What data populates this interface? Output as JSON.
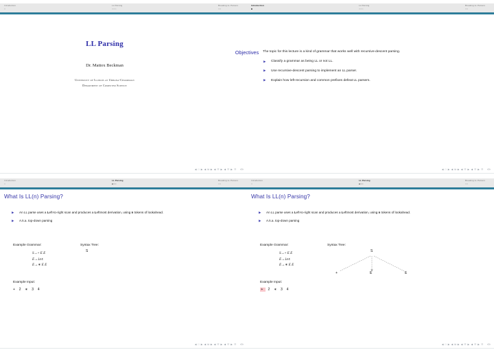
{
  "nav": {
    "sections": [
      "Introduction",
      "LL Parsing",
      "Breaking LL Parsers"
    ],
    "dots_intro_inactive": "○",
    "dots_intro_active": "■",
    "dots_ll": "○○○",
    "dots_ll_active": "●○○",
    "dots_breaking": "○○"
  },
  "footer": {
    "nav_glyphs": "◀ □ ▶ ◀ ⧉ ▶ ◀ ☷ ▶ ◀ ☷ ▶   ☷",
    "quad": "‹Ο›"
  },
  "slide1": {
    "header_title": "Objectives",
    "title": "LL Parsing",
    "author": "Dr. Mattox Beckman",
    "institution_line1": "University of Illinois at Urbana-Champaign",
    "institution_line2": "Department of Computer Science",
    "lead": "The topic for this lecture is a kind of grammar that works well with recursive-descent parsing.",
    "objectives": [
      "Classify a grammar as being LL or not LL.",
      "Use recursive-descent parsing to implement an LL parser.",
      "Explain how left-recursion and common prefixes defeat LL parsers."
    ],
    "bullet_glyph": "▶"
  },
  "slide2": {
    "frame_title": "What Is LL(n) Parsing?",
    "point1_a": "An LL parse uses a ",
    "point1_L1": "L",
    "point1_b": "eft-to-right scan and produces a ",
    "point1_L2": "L",
    "point1_c": "eftmost derivation, using ",
    "point1_n": "n",
    "point1_d": " tokens of lookahead.",
    "point2": "A.k.a. top-down parsing",
    "grammar_label": "Example Grammar:",
    "tree_label": "Syntax Tree:",
    "rules": [
      {
        "lhs": "S",
        "arrow": "→",
        "rhs_op": "+",
        "rhs": " E E",
        "mono": false
      },
      {
        "lhs": "E",
        "arrow": "→",
        "rhs_op": "",
        "rhs": "int",
        "mono": true
      },
      {
        "lhs": "E",
        "arrow": "→",
        "rhs_op": "∗",
        "rhs": " E E",
        "mono": false
      }
    ],
    "input_label": "Example Input:",
    "input_tokens": "+  2  ∗  3  4",
    "tree_root": "S"
  },
  "slide3": {
    "frame_title": "What Is LL(n) Parsing?",
    "input_highlight_token": "+",
    "input_rest": "2  ∗  3  4",
    "tree_root": "S",
    "tree_child_left": "+",
    "tree_child_mid": "E",
    "tree_child_right": "E"
  },
  "colors": {
    "title_blue": "#2d2da8",
    "frame_title_blue": "#3535a8",
    "rule_teal": "#2b7d9b",
    "header_gray": "#e8e8e8",
    "highlight_pink": "#f9c8cc"
  }
}
